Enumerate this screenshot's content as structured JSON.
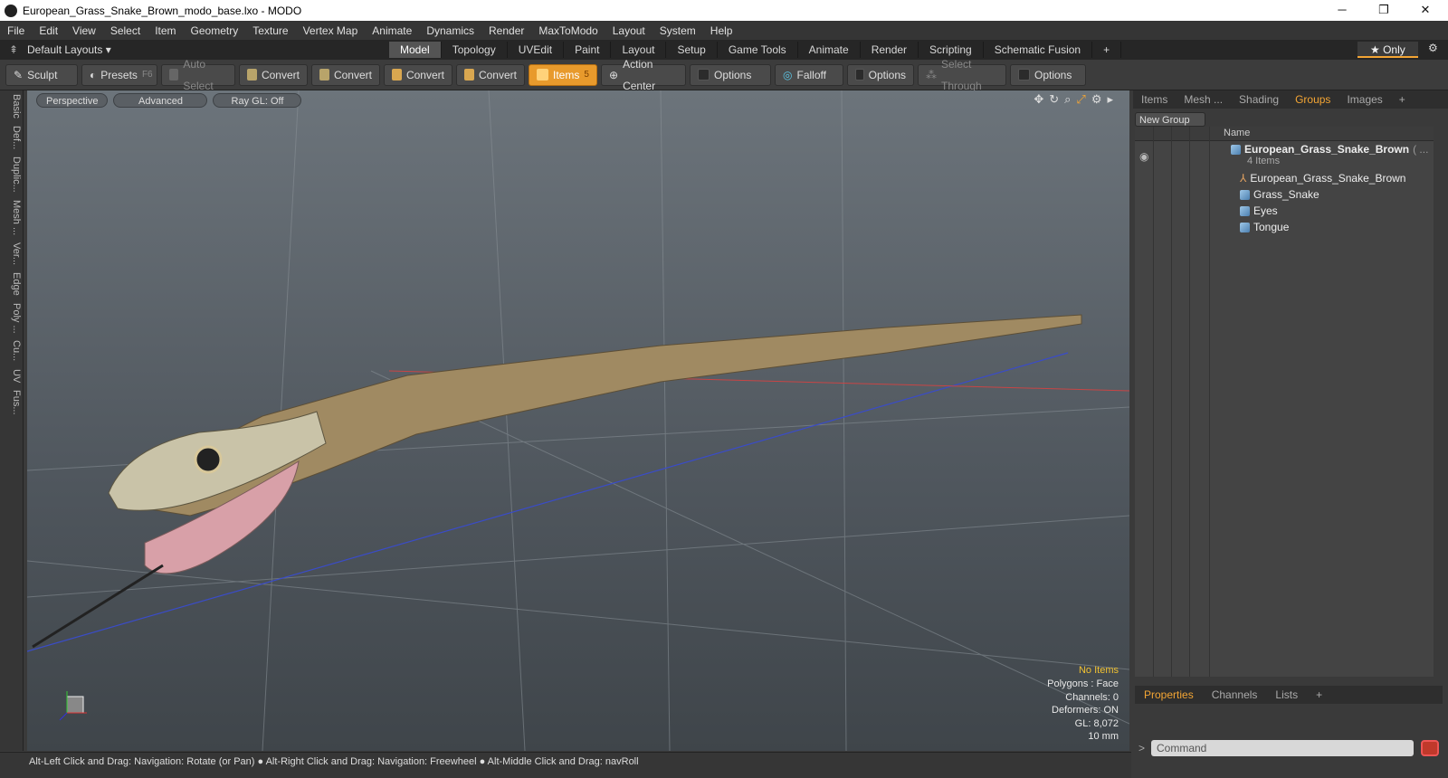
{
  "window": {
    "title": "European_Grass_Snake_Brown_modo_base.lxo - MODO",
    "controls": [
      "─",
      "❐",
      "✕"
    ]
  },
  "menu": [
    "File",
    "Edit",
    "View",
    "Select",
    "Item",
    "Geometry",
    "Texture",
    "Vertex Map",
    "Animate",
    "Dynamics",
    "Render",
    "MaxToModo",
    "Layout",
    "System",
    "Help"
  ],
  "layoutbar": {
    "layouts_label": "Default Layouts ▾",
    "tabs": [
      "Model",
      "Topology",
      "UVEdit",
      "Paint",
      "Layout",
      "Setup",
      "Game Tools",
      "Animate",
      "Render",
      "Scripting",
      "Schematic Fusion"
    ],
    "active_tab": "Model",
    "only_label": "★  Only"
  },
  "toolbar": {
    "sculpt": "Sculpt",
    "presets": "Presets",
    "presets_key": "F6",
    "auto_select": "Auto Select",
    "convert": "Convert",
    "items": "Items",
    "items_badge": "5",
    "action_center": "Action Center",
    "options": "Options",
    "falloff": "Falloff",
    "select_through": "Select Through"
  },
  "lefttabs": [
    "Basic",
    "Def...",
    "Duplic...",
    "Mesh ...",
    "Ver...",
    "Edge",
    "Poly ...",
    "Cu...",
    "UV",
    "Fus..."
  ],
  "viewport": {
    "view": "Perspective",
    "shading": "Advanced",
    "raygl": "Ray GL: Off",
    "info": {
      "selection": "No Items",
      "polygons": "Polygons : Face",
      "channels": "Channels: 0",
      "deformers": "Deformers: ON",
      "gl": "GL: 8,072",
      "unit": "10 mm"
    }
  },
  "status": "Alt-Left Click and Drag: Navigation: Rotate (or Pan) ● Alt-Right Click and Drag: Navigation: Freewheel ● Alt-Middle Click and Drag: navRoll",
  "rightpanel": {
    "tabs": [
      "Items",
      "Mesh ...",
      "Shading",
      "Groups",
      "Images"
    ],
    "active_tab": "Groups",
    "new_group": "New Group",
    "name_header": "Name",
    "group": {
      "name": "European_Grass_Snake_Brown",
      "suffix": "( ...",
      "count": "4 Items"
    },
    "children": [
      "European_Grass_Snake_Brown",
      "Grass_Snake",
      "Eyes",
      "Tongue"
    ],
    "bottom_tabs": [
      "Properties",
      "Channels",
      "Lists"
    ],
    "active_bottom": "Properties",
    "command_placeholder": "Command"
  },
  "colors": {
    "accent": "#f3a534",
    "active_tool": "#e89a2c"
  }
}
